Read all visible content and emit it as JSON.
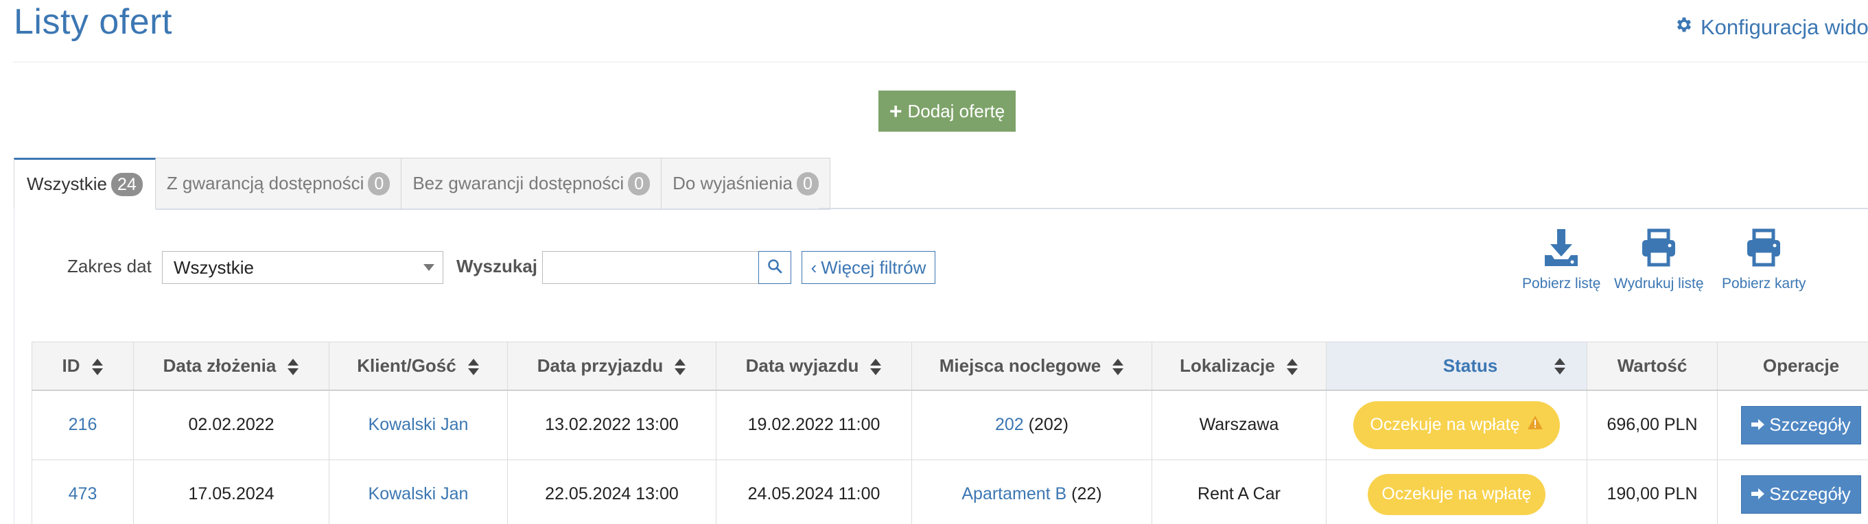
{
  "page": {
    "title": "Listy ofert",
    "config_link": "Konfiguracja widok"
  },
  "add_button": "Dodaj ofertę",
  "tabs": [
    {
      "label": "Wszystkie",
      "count": "24"
    },
    {
      "label": "Z gwarancją dostępności",
      "count": "0"
    },
    {
      "label": "Bez gwarancji dostępności",
      "count": "0"
    },
    {
      "label": "Do wyjaśnienia",
      "count": "0"
    }
  ],
  "filters": {
    "date_range_label": "Zakres dat",
    "date_range_value": "Wszystkie",
    "search_label": "Wyszukaj",
    "search_value": "",
    "more_filters": "Więcej filtrów"
  },
  "actions": {
    "download_list": "Pobierz listę",
    "print_list": "Wydrukuj listę",
    "download_cards": "Pobierz karty"
  },
  "table": {
    "headers": [
      "ID",
      "Data złożenia",
      "Klient/Gość",
      "Data przyjazdu",
      "Data wyjazdu",
      "Miejsca noclegowe",
      "Lokalizacje",
      "Status",
      "Wartość",
      "Operacje"
    ],
    "rows": [
      {
        "id": "216",
        "created": "02.02.2022",
        "client": "Kowalski Jan",
        "arrival": "13.02.2022 13:00",
        "departure": "19.02.2022 11:00",
        "place_link": "202",
        "place_suffix": "(202)",
        "location": "Warszawa",
        "status": "Oczekuje na wpłatę",
        "status_warning": true,
        "value": "696,00 PLN",
        "operation": "Szczegóły"
      },
      {
        "id": "473",
        "created": "17.05.2024",
        "client": "Kowalski Jan",
        "arrival": "22.05.2024 13:00",
        "departure": "24.05.2024 11:00",
        "place_link": "Apartament B",
        "place_suffix": "(22)",
        "location": "Rent A Car",
        "status": "Oczekuje na wpłatę",
        "status_warning": false,
        "value": "190,00 PLN",
        "operation": "Szczegóły"
      }
    ]
  },
  "colors": {
    "primary": "#3c77b3",
    "add_button": "#7ea36a",
    "status_pending": "#f8d24d",
    "warning_icon": "#e8a227",
    "details_button": "#4f87c3"
  }
}
